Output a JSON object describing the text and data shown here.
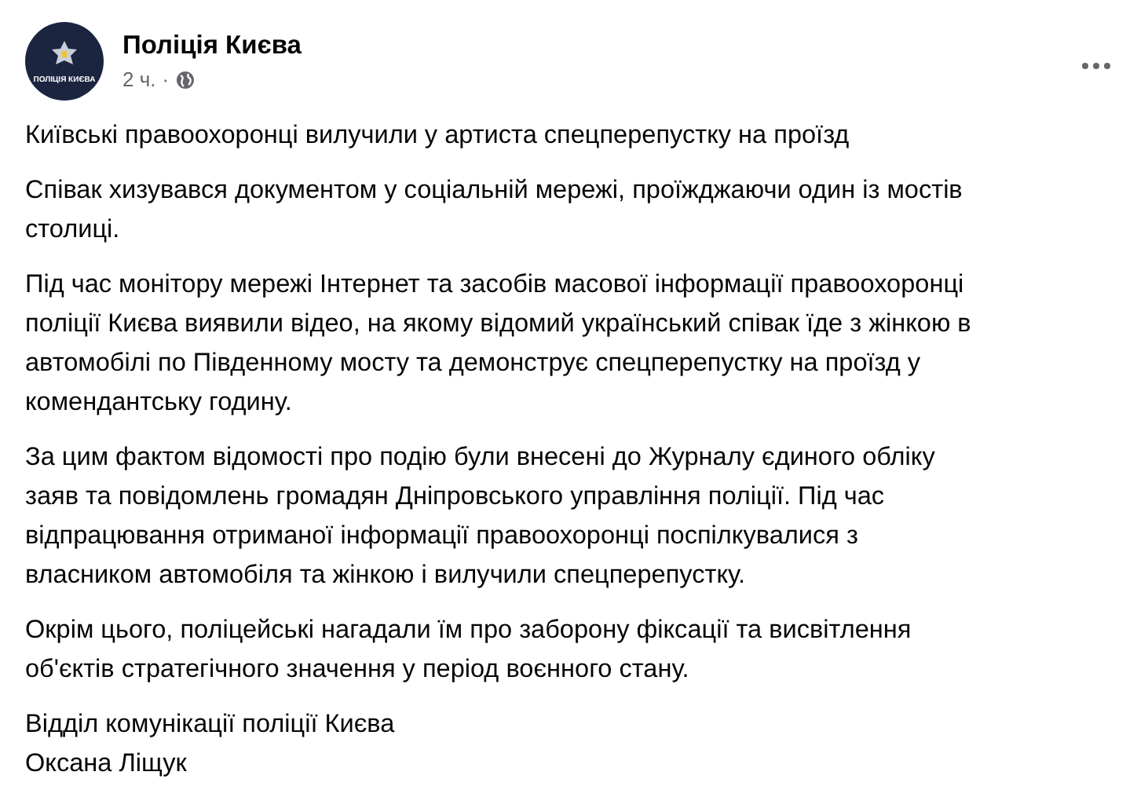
{
  "post": {
    "author": "Поліція Києва",
    "avatar_text": "ПОЛІЦІЯ КИЄВА",
    "time": "2 ч.",
    "separator": "·",
    "paragraphs": [
      {
        "lines": [
          "Київські правоохоронці вилучили у артиста спецперепустку на проїзд"
        ]
      },
      {
        "lines": [
          "Співак хизувався документом у соціальній мережі, проїжджаючи один із мостів",
          "столиці."
        ]
      },
      {
        "lines": [
          "Під час монітору мережі Інтернет та засобів масової інформації правоохоронці",
          "поліції Києва виявили відео, на якому відомий український співак їде з жінкою в",
          "автомобілі по Південному мосту та демонструє спецперепустку на проїзд у",
          "комендантську годину."
        ]
      },
      {
        "lines": [
          "За цим фактом відомості про подію були внесені до Журналу єдиного обліку",
          "заяв та повідомлень громадян Дніпровського управління поліції. Під час",
          "відпрацювання отриманої інформації правоохоронці поспілкувалися з",
          "власником автомобіля та жінкою і вилучили спецперепустку."
        ]
      },
      {
        "lines": [
          "Окрім цього, поліцейські нагадали їм про заборону фіксації та висвітлення",
          "об'єктів стратегічного значення у період воєнного стану."
        ]
      },
      {
        "lines": [
          "Відділ комунікації поліції Києва",
          "Оксана Ліщук"
        ]
      }
    ]
  }
}
